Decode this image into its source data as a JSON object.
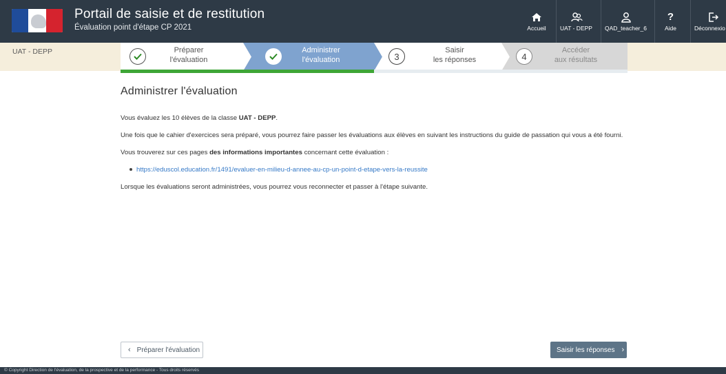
{
  "header": {
    "title": "Portail de saisie et de restitution",
    "subtitle": "Évaluation point d'étape CP 2021",
    "nav": [
      {
        "label": "Accueil",
        "icon": "home-icon"
      },
      {
        "label": "UAT - DEPP",
        "icon": "users-icon"
      },
      {
        "label": "QAD_teacher_6",
        "icon": "user-icon"
      },
      {
        "label": "Aide",
        "icon": "help-icon"
      },
      {
        "label": "Déconnexio",
        "icon": "logout-icon"
      }
    ]
  },
  "stepbar": {
    "class_name": "UAT - DEPP",
    "steps": [
      {
        "line1": "Préparer",
        "line2": "l'évaluation",
        "state": "done"
      },
      {
        "line1": "Administrer",
        "line2": "l'évaluation",
        "state": "current"
      },
      {
        "number": "3",
        "line1": "Saisir",
        "line2": "les réponses",
        "state": "todo"
      },
      {
        "number": "4",
        "line1": "Accéder",
        "line2": "aux résultats",
        "state": "disabled"
      }
    ]
  },
  "main": {
    "title": "Administrer l'évaluation",
    "p1_prefix": "Vous évaluez les 10 élèves de la classe ",
    "p1_class": "UAT - DEPP",
    "p1_suffix": ".",
    "p2": "Une fois que le cahier d'exercices sera préparé, vous pourrez faire passer les évaluations aux élèves en suivant les instructions du guide de passation qui vous a été fourni.",
    "p3_prefix": "Vous trouverez sur ces pages ",
    "p3_bold": "des informations importantes",
    "p3_suffix": " concernant cette évaluation :",
    "link": "https://eduscol.education.fr/1491/evaluer-en-milieu-d-annee-au-cp-un-point-d-etape-vers-la-reussite",
    "p4": "Lorsque les évaluations seront administrées, vous pourrez vous reconnecter et passer à l'étape suivante."
  },
  "buttons": {
    "prev_label": "Préparer l'évaluation",
    "next_label": "Saisir les réponses"
  },
  "footer": {
    "text": "© Copyright Direction de l'évaluation, de la prospective et de la performance - Tous droits réservés"
  },
  "colors": {
    "header_bg": "#2e3a46",
    "stepbar_bg": "#f5eedc",
    "done_step_bg": "#ffffff",
    "current_step_bg": "#7fa3cf",
    "todo_step_bg": "#ffffff",
    "disabled_step_bg": "#d7d7d7",
    "progress_green": "#3ea636",
    "link": "#3579c7",
    "primary_button": "#5d7487"
  }
}
